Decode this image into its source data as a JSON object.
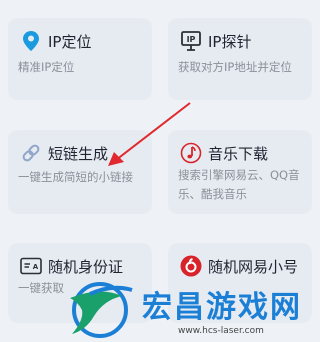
{
  "cards": [
    {
      "title": "IP定位",
      "desc": "精准IP定位",
      "icon": "location-pin-icon"
    },
    {
      "title": "IP探针",
      "desc": "获取对方IP地址并定位",
      "icon": "ip-probe-icon"
    },
    {
      "title": "短链生成",
      "desc": "一键生成简短的小链接",
      "icon": "link-icon"
    },
    {
      "title": "音乐下载",
      "desc": "搜索引擎网易云、QQ音乐、酷我音乐",
      "icon": "music-note-icon"
    },
    {
      "title": "随机身份证",
      "desc": "一键获取",
      "icon": "id-card-icon"
    },
    {
      "title": "随机网易小号",
      "desc": "",
      "icon": "netease-icon"
    }
  ],
  "watermark": {
    "text": "宏昌游戏网",
    "url": "www.hcs-laser.com"
  },
  "colors": {
    "accent_blue": "#1a9be0",
    "arrow_red": "#e0282e",
    "netease_red": "#d8232a"
  }
}
